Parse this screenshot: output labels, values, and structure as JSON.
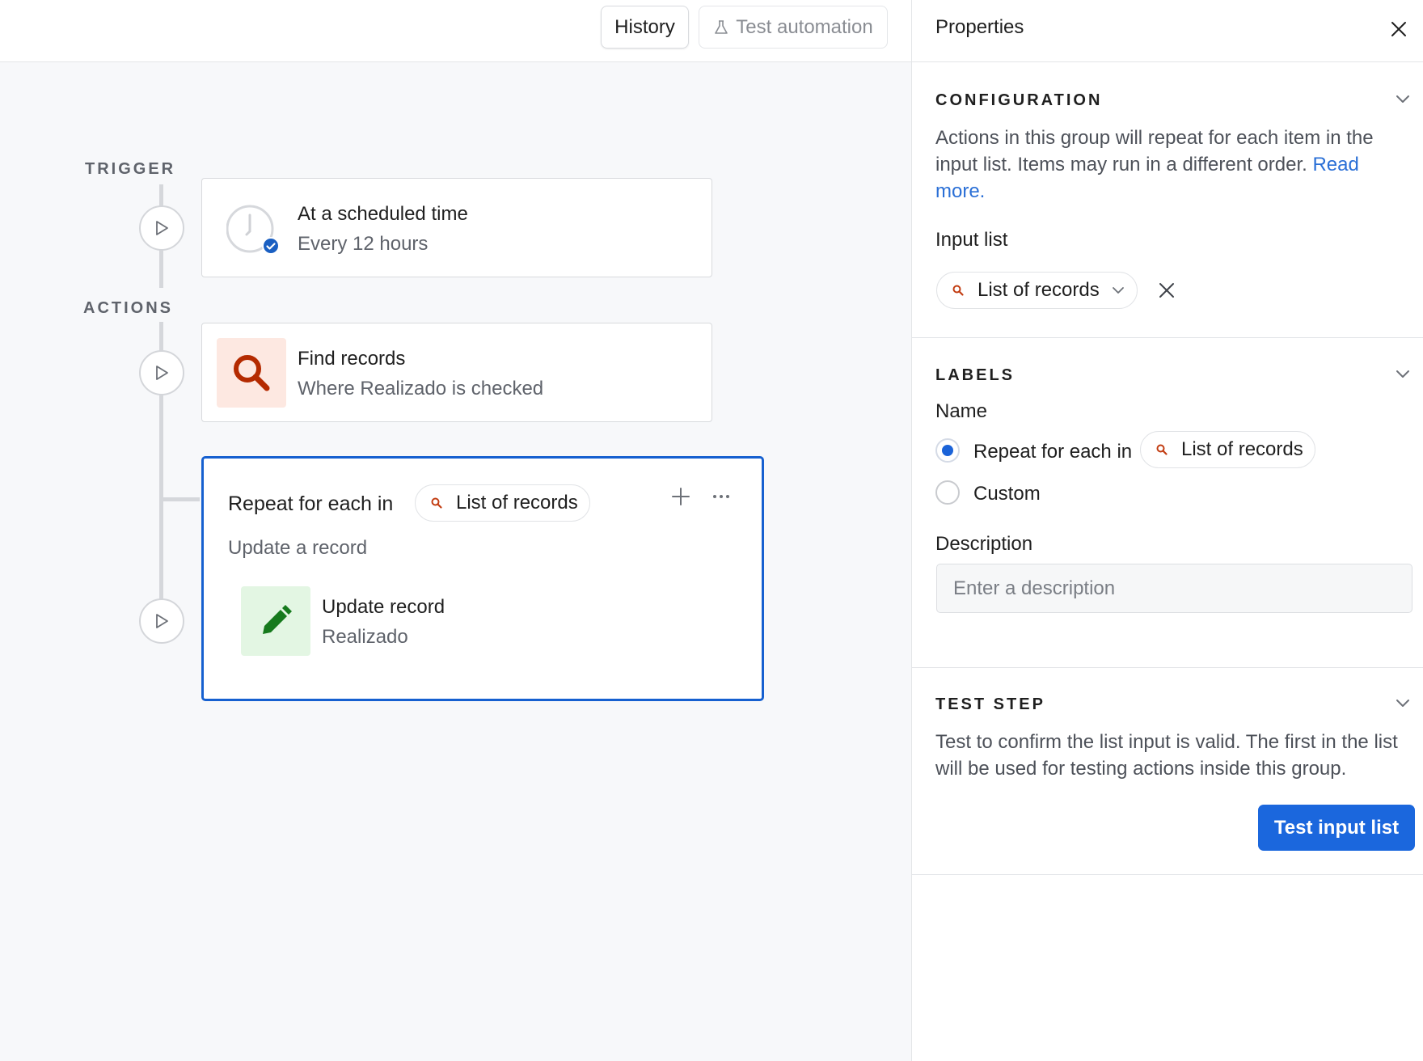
{
  "toolbar": {
    "history_label": "History",
    "test_automation_label": "Test automation"
  },
  "canvas": {
    "trigger_label": "TRIGGER",
    "actions_label": "ACTIONS",
    "trigger_card": {
      "title": "At a scheduled time",
      "subtitle": "Every 12 hours"
    },
    "find_card": {
      "title": "Find records",
      "subtitle": "Where Realizado is checked"
    },
    "repeat_group": {
      "title_prefix": "Repeat for each in",
      "pill_label": "List of records",
      "subtitle": "Update a record",
      "inner_card": {
        "title": "Update record",
        "subtitle": "Realizado"
      }
    }
  },
  "panel": {
    "title": "Properties",
    "configuration": {
      "heading": "CONFIGURATION",
      "description": "Actions in this group will repeat for each item in the input list. Items may run in a different order.",
      "read_more": "Read more.",
      "input_list_label": "Input list",
      "input_list_value": "List of records"
    },
    "labels": {
      "heading": "LABELS",
      "name_label": "Name",
      "option_default": "Repeat for each in",
      "option_default_pill": "List of records",
      "option_custom": "Custom",
      "description_label": "Description",
      "description_placeholder": "Enter a description"
    },
    "test_step": {
      "heading": "TEST STEP",
      "description": "Test to confirm the list input is valid. The first in the list will be used for testing actions inside this group.",
      "button_label": "Test input list"
    }
  },
  "colors": {
    "accent": "#1b67dd",
    "selected_border": "#1660d0",
    "find_icon": "#b42a00",
    "find_icon_bg": "#fde8e1",
    "update_icon": "#167a1d",
    "update_icon_bg": "#e3f6e3"
  },
  "icons": {
    "clock": "clock-icon",
    "check_badge": "check-badge-icon",
    "search": "search-icon",
    "pencil": "pencil-icon",
    "play": "play-icon",
    "plus": "plus-icon",
    "more": "more-icon",
    "close": "close-icon",
    "chevron": "chevron-down-icon",
    "flask": "flask-icon"
  }
}
